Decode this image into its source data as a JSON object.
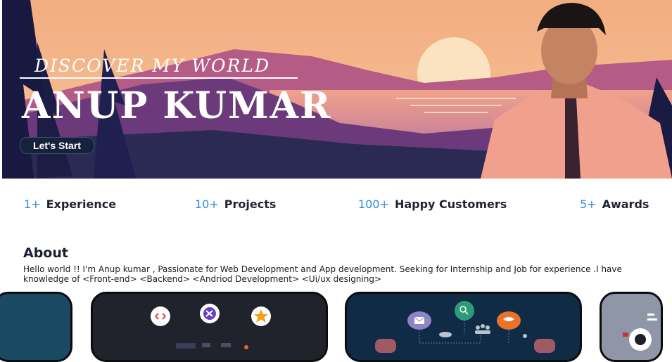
{
  "hero": {
    "subtitle": "DISCOVER MY WORLD",
    "name": "ANUP KUMAR",
    "start_button": "Let's Start"
  },
  "stats": [
    {
      "num": "1+",
      "label": "Experience"
    },
    {
      "num": "10+",
      "label": "Projects"
    },
    {
      "num": "100+",
      "label": "Happy Customers"
    },
    {
      "num": "5+",
      "label": "Awards"
    }
  ],
  "about": {
    "title": "About",
    "text": "Hello world !! I'm Anup kumar , Passionate for Web Development and App development. Seeking for Internship and Job for experience .I have knowledge of <Front-end> <Backend> <Andriod Development> <Ui/ux designing>"
  },
  "colors": {
    "accent": "#2f8be0",
    "hero_dark": "#1e2246",
    "sky": "#f3b183",
    "card_navy": "#0f2b45"
  },
  "icons": [
    "code-icon",
    "visual-studio-icon",
    "star-icon",
    "mail-icon",
    "search-icon",
    "users-icon",
    "chat-icon"
  ]
}
